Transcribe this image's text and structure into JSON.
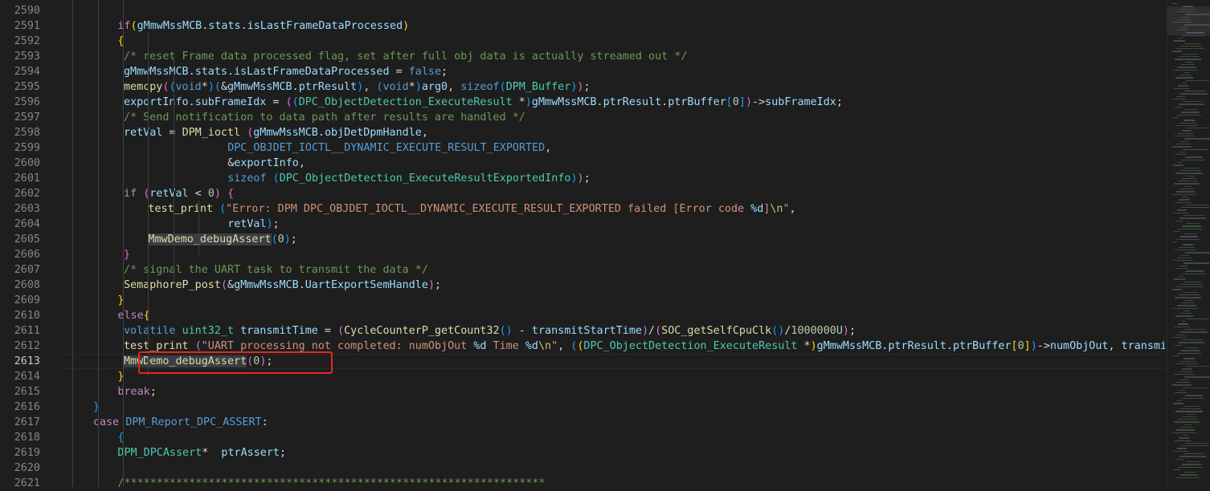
{
  "editor": {
    "current_line": 2613,
    "highlight_color": "#e8251f",
    "lines": [
      {
        "num": "2590",
        "tokens": []
      },
      {
        "num": "2591",
        "tokens": [
          [
            "ctl",
            "if"
          ],
          [
            "b1",
            "("
          ],
          [
            "var",
            "gMmwMssMCB"
          ],
          [
            "pl",
            "."
          ],
          [
            "var",
            "stats"
          ],
          [
            "pl",
            "."
          ],
          [
            "var",
            "isLastFrameDataProcessed"
          ],
          [
            "b1",
            ")"
          ]
        ]
      },
      {
        "num": "2592",
        "tokens": [
          [
            "b1",
            "{"
          ]
        ]
      },
      {
        "num": "2593",
        "tokens": [
          [
            "cmt",
            "/* reset Frame data processed flag, set after full obj data is actually streamed out */"
          ]
        ]
      },
      {
        "num": "2594",
        "tokens": [
          [
            "var",
            "gMmwMssMCB"
          ],
          [
            "pl",
            "."
          ],
          [
            "var",
            "stats"
          ],
          [
            "pl",
            "."
          ],
          [
            "var",
            "isLastFrameDataProcessed"
          ],
          [
            "pl",
            " = "
          ],
          [
            "kw",
            "false"
          ],
          [
            "pl",
            ";"
          ]
        ]
      },
      {
        "num": "2595",
        "tokens": [
          [
            "fn",
            "memcpy"
          ],
          [
            "b2",
            "("
          ],
          [
            "b3",
            "("
          ],
          [
            "kw",
            "void"
          ],
          [
            "pl",
            "*"
          ],
          [
            "b3",
            ")"
          ],
          [
            "b3",
            "("
          ],
          [
            "pl",
            "&"
          ],
          [
            "var",
            "gMmwMssMCB"
          ],
          [
            "pl",
            "."
          ],
          [
            "var",
            "ptrResult"
          ],
          [
            "b3",
            ")"
          ],
          [
            "pl",
            ", "
          ],
          [
            "b3",
            "("
          ],
          [
            "kw",
            "void"
          ],
          [
            "pl",
            "*"
          ],
          [
            "b3",
            ")"
          ],
          [
            "var",
            "arg0"
          ],
          [
            "pl",
            ", "
          ],
          [
            "kw",
            "sizeof"
          ],
          [
            "b3",
            "("
          ],
          [
            "typ",
            "DPM_Buffer"
          ],
          [
            "b3",
            ")"
          ],
          [
            "b2",
            ")"
          ],
          [
            "pl",
            ";"
          ]
        ]
      },
      {
        "num": "2596",
        "tokens": [
          [
            "var",
            "exportInfo"
          ],
          [
            "pl",
            "."
          ],
          [
            "var",
            "subFrameIdx"
          ],
          [
            "pl",
            " = "
          ],
          [
            "b2",
            "("
          ],
          [
            "b3",
            "("
          ],
          [
            "typ",
            "DPC_ObjectDetection_ExecuteResult"
          ],
          [
            "pl",
            " *"
          ],
          [
            "b3",
            ")"
          ],
          [
            "var",
            "gMmwMssMCB"
          ],
          [
            "pl",
            "."
          ],
          [
            "var",
            "ptrResult"
          ],
          [
            "pl",
            "."
          ],
          [
            "var",
            "ptrBuffer"
          ],
          [
            "b3",
            "["
          ],
          [
            "num",
            "0"
          ],
          [
            "b3",
            "]"
          ],
          [
            "b2",
            ")"
          ],
          [
            "pl",
            "->"
          ],
          [
            "var",
            "subFrameIdx"
          ],
          [
            "pl",
            ";"
          ]
        ]
      },
      {
        "num": "2597",
        "tokens": [
          [
            "cmt",
            "/* Send notification to data path after results are handled */"
          ]
        ]
      },
      {
        "num": "2598",
        "tokens": [
          [
            "var",
            "retVal"
          ],
          [
            "pl",
            " = "
          ],
          [
            "fn",
            "DPM_ioctl"
          ],
          [
            "pl",
            " "
          ],
          [
            "b2",
            "("
          ],
          [
            "var",
            "gMmwMssMCB"
          ],
          [
            "pl",
            "."
          ],
          [
            "var",
            "objDetDpmHandle"
          ],
          [
            "pl",
            ","
          ]
        ]
      },
      {
        "num": "2599",
        "tokens": [
          [
            "mac",
            "DPC_OBJDET_IOCTL__DYNAMIC_EXECUTE_RESULT_EXPORTED"
          ],
          [
            "pl",
            ","
          ]
        ]
      },
      {
        "num": "2600",
        "tokens": [
          [
            "pl",
            "&"
          ],
          [
            "var",
            "exportInfo"
          ],
          [
            "pl",
            ","
          ]
        ]
      },
      {
        "num": "2601",
        "tokens": [
          [
            "kw",
            "sizeof"
          ],
          [
            "pl",
            " "
          ],
          [
            "b3",
            "("
          ],
          [
            "typ",
            "DPC_ObjectDetection_ExecuteResultExportedInfo"
          ],
          [
            "b3",
            ")"
          ],
          [
            "b2",
            ")"
          ],
          [
            "pl",
            ";"
          ]
        ]
      },
      {
        "num": "2602",
        "tokens": [
          [
            "ctl",
            "if"
          ],
          [
            "pl",
            " "
          ],
          [
            "b2",
            "("
          ],
          [
            "var",
            "retVal"
          ],
          [
            "pl",
            " < "
          ],
          [
            "num",
            "0"
          ],
          [
            "b2",
            ")"
          ],
          [
            "pl",
            " "
          ],
          [
            "b2",
            "{"
          ]
        ]
      },
      {
        "num": "2603",
        "tokens": [
          [
            "fn",
            "test_print"
          ],
          [
            "pl",
            " "
          ],
          [
            "b3",
            "("
          ],
          [
            "str",
            "\"Error: DPM DPC_OBJDET_IOCTL__DYNAMIC_EXECUTE_RESULT_EXPORTED failed [Error code "
          ],
          [
            "var",
            "%d"
          ],
          [
            "str",
            "]"
          ],
          [
            "esc",
            "\\n"
          ],
          [
            "str",
            "\""
          ],
          [
            "pl",
            ","
          ]
        ]
      },
      {
        "num": "2604",
        "tokens": [
          [
            "var",
            "retVal"
          ],
          [
            "b3",
            ")"
          ],
          [
            "pl",
            ";"
          ]
        ]
      },
      {
        "num": "2605",
        "tokens": [
          [
            "fn",
            "MmwDemo_debugAssert"
          ],
          [
            "b3",
            "("
          ],
          [
            "num",
            "0"
          ],
          [
            "b3",
            ")"
          ],
          [
            "pl",
            ";"
          ]
        ]
      },
      {
        "num": "2606",
        "tokens": [
          [
            "b2",
            "}"
          ]
        ]
      },
      {
        "num": "2607",
        "tokens": [
          [
            "cmt",
            "/* signal the UART task to transmit the data */"
          ]
        ]
      },
      {
        "num": "2608",
        "tokens": [
          [
            "fn",
            "SemaphoreP_post"
          ],
          [
            "b2",
            "("
          ],
          [
            "pl",
            "&"
          ],
          [
            "var",
            "gMmwMssMCB"
          ],
          [
            "pl",
            "."
          ],
          [
            "var",
            "UartExportSemHandle"
          ],
          [
            "b2",
            ")"
          ],
          [
            "pl",
            ";"
          ]
        ]
      },
      {
        "num": "2609",
        "tokens": [
          [
            "b1",
            "}"
          ]
        ]
      },
      {
        "num": "2610",
        "tokens": [
          [
            "ctl",
            "else"
          ],
          [
            "b1",
            "{"
          ]
        ]
      },
      {
        "num": "2611",
        "tokens": [
          [
            "kw",
            "volatile"
          ],
          [
            "pl",
            " "
          ],
          [
            "typ",
            "uint32_t"
          ],
          [
            "pl",
            " "
          ],
          [
            "var",
            "transmitTime"
          ],
          [
            "pl",
            " = "
          ],
          [
            "b2",
            "("
          ],
          [
            "fn",
            "CycleCounterP_getCount32"
          ],
          [
            "b3",
            "()"
          ],
          [
            "pl",
            " - "
          ],
          [
            "var",
            "transmitStartTime"
          ],
          [
            "b2",
            ")"
          ],
          [
            "pl",
            "/"
          ],
          [
            "b2",
            "("
          ],
          [
            "fn",
            "SOC_getSelfCpuClk"
          ],
          [
            "b3",
            "()"
          ],
          [
            "pl",
            "/"
          ],
          [
            "num",
            "1000000U"
          ],
          [
            "b2",
            ")"
          ],
          [
            "pl",
            ";"
          ]
        ]
      },
      {
        "num": "2612",
        "tokens": [
          [
            "fn",
            "test_print"
          ],
          [
            "pl",
            " "
          ],
          [
            "b2",
            "("
          ],
          [
            "str",
            "\"UART processing not completed: numObjOut "
          ],
          [
            "var",
            "%d"
          ],
          [
            "str",
            " Time "
          ],
          [
            "var",
            "%d"
          ],
          [
            "esc",
            "\\n"
          ],
          [
            "str",
            "\""
          ],
          [
            "pl",
            ", "
          ],
          [
            "b3",
            "("
          ],
          [
            "b1",
            "("
          ],
          [
            "typ",
            "DPC_ObjectDetection_ExecuteResult"
          ],
          [
            "pl",
            " *"
          ],
          [
            "b1",
            ")"
          ],
          [
            "var",
            "gMmwMssMCB"
          ],
          [
            "pl",
            "."
          ],
          [
            "var",
            "ptrResult"
          ],
          [
            "pl",
            "."
          ],
          [
            "var",
            "ptrBuffer"
          ],
          [
            "b1",
            "["
          ],
          [
            "num",
            "0"
          ],
          [
            "b1",
            "]"
          ],
          [
            "b3",
            ")"
          ],
          [
            "pl",
            "->"
          ],
          [
            "var",
            "numObjOut"
          ],
          [
            "pl",
            ", "
          ],
          [
            "var",
            "transmitT"
          ]
        ]
      },
      {
        "num": "2613",
        "tokens": [
          [
            "fn",
            "MmwDemo_debugAssert"
          ],
          [
            "b2",
            "("
          ],
          [
            "num",
            "0"
          ],
          [
            "b2",
            ")"
          ],
          [
            "pl",
            ";"
          ]
        ]
      },
      {
        "num": "2614",
        "tokens": [
          [
            "b1",
            "}"
          ]
        ]
      },
      {
        "num": "2615",
        "tokens": [
          [
            "ctl",
            "break"
          ],
          [
            "pl",
            ";"
          ]
        ]
      },
      {
        "num": "2616",
        "tokens": [
          [
            "b3",
            "}"
          ]
        ]
      },
      {
        "num": "2617",
        "tokens": [
          [
            "ctl",
            "case"
          ],
          [
            "pl",
            " "
          ],
          [
            "mac",
            "DPM_Report_DPC_ASSERT"
          ],
          [
            "pl",
            ":"
          ]
        ]
      },
      {
        "num": "2618",
        "tokens": [
          [
            "b3",
            "{"
          ]
        ]
      },
      {
        "num": "2619",
        "tokens": [
          [
            "typ",
            "DPM_DPCAssert"
          ],
          [
            "pl",
            "*  "
          ],
          [
            "var",
            "ptrAssert"
          ],
          [
            "pl",
            ";"
          ]
        ]
      },
      {
        "num": "2620",
        "tokens": []
      },
      {
        "num": "2621",
        "tokens": [
          [
            "cmt",
            "/*****************************************************************"
          ]
        ]
      }
    ]
  }
}
